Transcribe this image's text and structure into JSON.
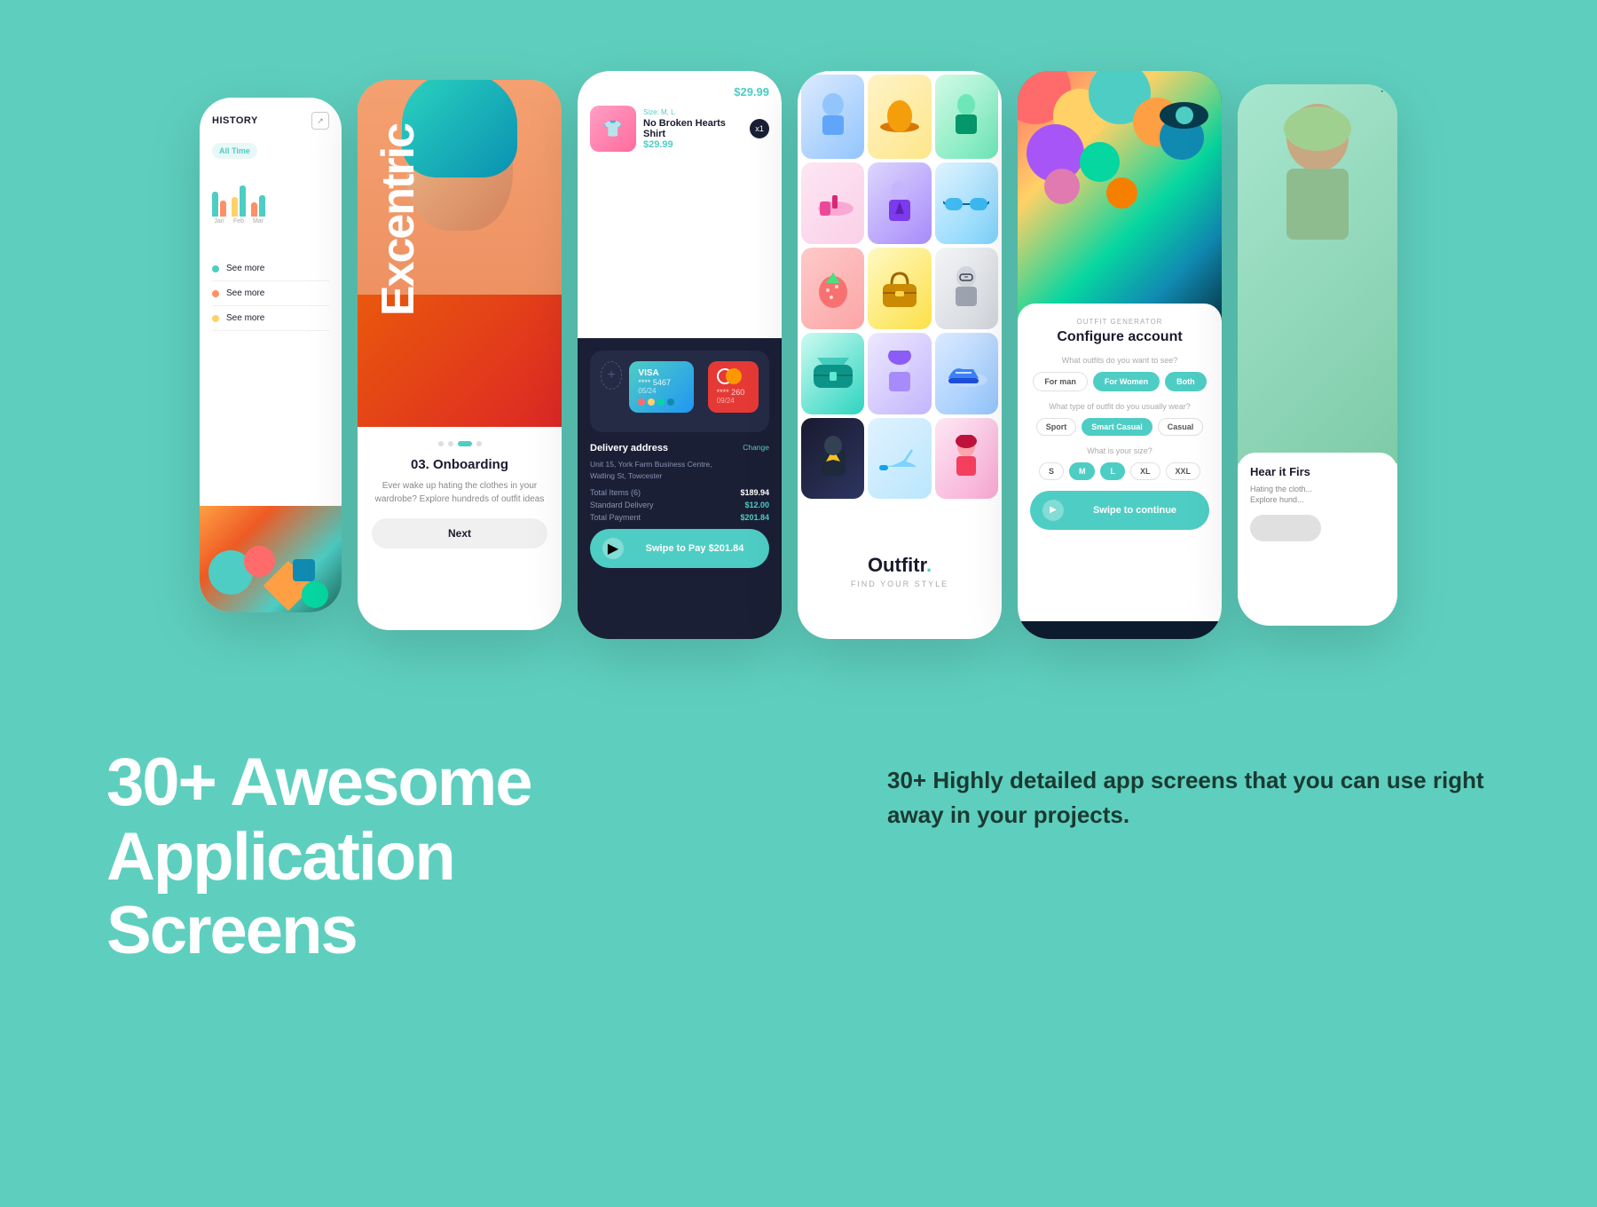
{
  "background_color": "#5ecfbe",
  "screens": {
    "screen1": {
      "title": "HISTORY",
      "badge": "All Time",
      "see_more_items": [
        "See more",
        "See more",
        "See more"
      ],
      "chart_months": [
        "Jan",
        "Feb",
        "Mar"
      ]
    },
    "screen2": {
      "brand": "Excentric",
      "card_number": "03. Onboarding",
      "card_text": "Ever wake up hating the clothes in your wardrobe? Explore hundreds of outfit ideas",
      "next_button": "Next"
    },
    "screen3": {
      "price_top": "$29.99",
      "item": {
        "size_label": "Size:",
        "sizes": "M, L",
        "name": "No Broken Hearts Shirt",
        "price": "$29.99",
        "quantity": "x1"
      },
      "visa": {
        "label": "VISA",
        "number": "**** 5467",
        "expiry": "05/24",
        "number2": "**** 260",
        "expiry2": "09/24"
      },
      "delivery": {
        "title": "Delivery address",
        "address": "Unit 15, York Farm Business Centre,\nWatling St, Towcester",
        "change": "Change"
      },
      "totals": {
        "items_label": "Total Items (6)",
        "items_val": "$189.94",
        "delivery_label": "Standard Delivery",
        "delivery_val": "$12.00",
        "payment_label": "Total Payment",
        "payment_val": "$201.84"
      },
      "swipe_button": "Swipe to Pay $201.84"
    },
    "screen4": {
      "logo": "Outfitr.",
      "tagline": "FIND YOUR STYLE"
    },
    "screen5": {
      "subtitle": "OUTFIT GENERATOR",
      "title": "Configure account",
      "question1": "What outfits do you want to see?",
      "outfit_options": [
        "For man",
        "For Women",
        "Both"
      ],
      "question2": "What type of outfit do you usually wear?",
      "outfit_type_options": [
        "Sport",
        "Smart Casual",
        "Casual"
      ],
      "question3": "What is your size?",
      "size_options": [
        "S",
        "M",
        "L",
        "XL",
        "XXL"
      ],
      "swipe_button": "Swipe to continue"
    },
    "screen6": {
      "title": "Hear it Firs",
      "text": "Hating the cloth... Explore hund..."
    }
  },
  "bottom": {
    "headline_line1": "30+ Awesome",
    "headline_line2": "Application",
    "headline_line3": "Screens",
    "description": "30+ Highly detailed app screens that you can use right away in your projects."
  }
}
